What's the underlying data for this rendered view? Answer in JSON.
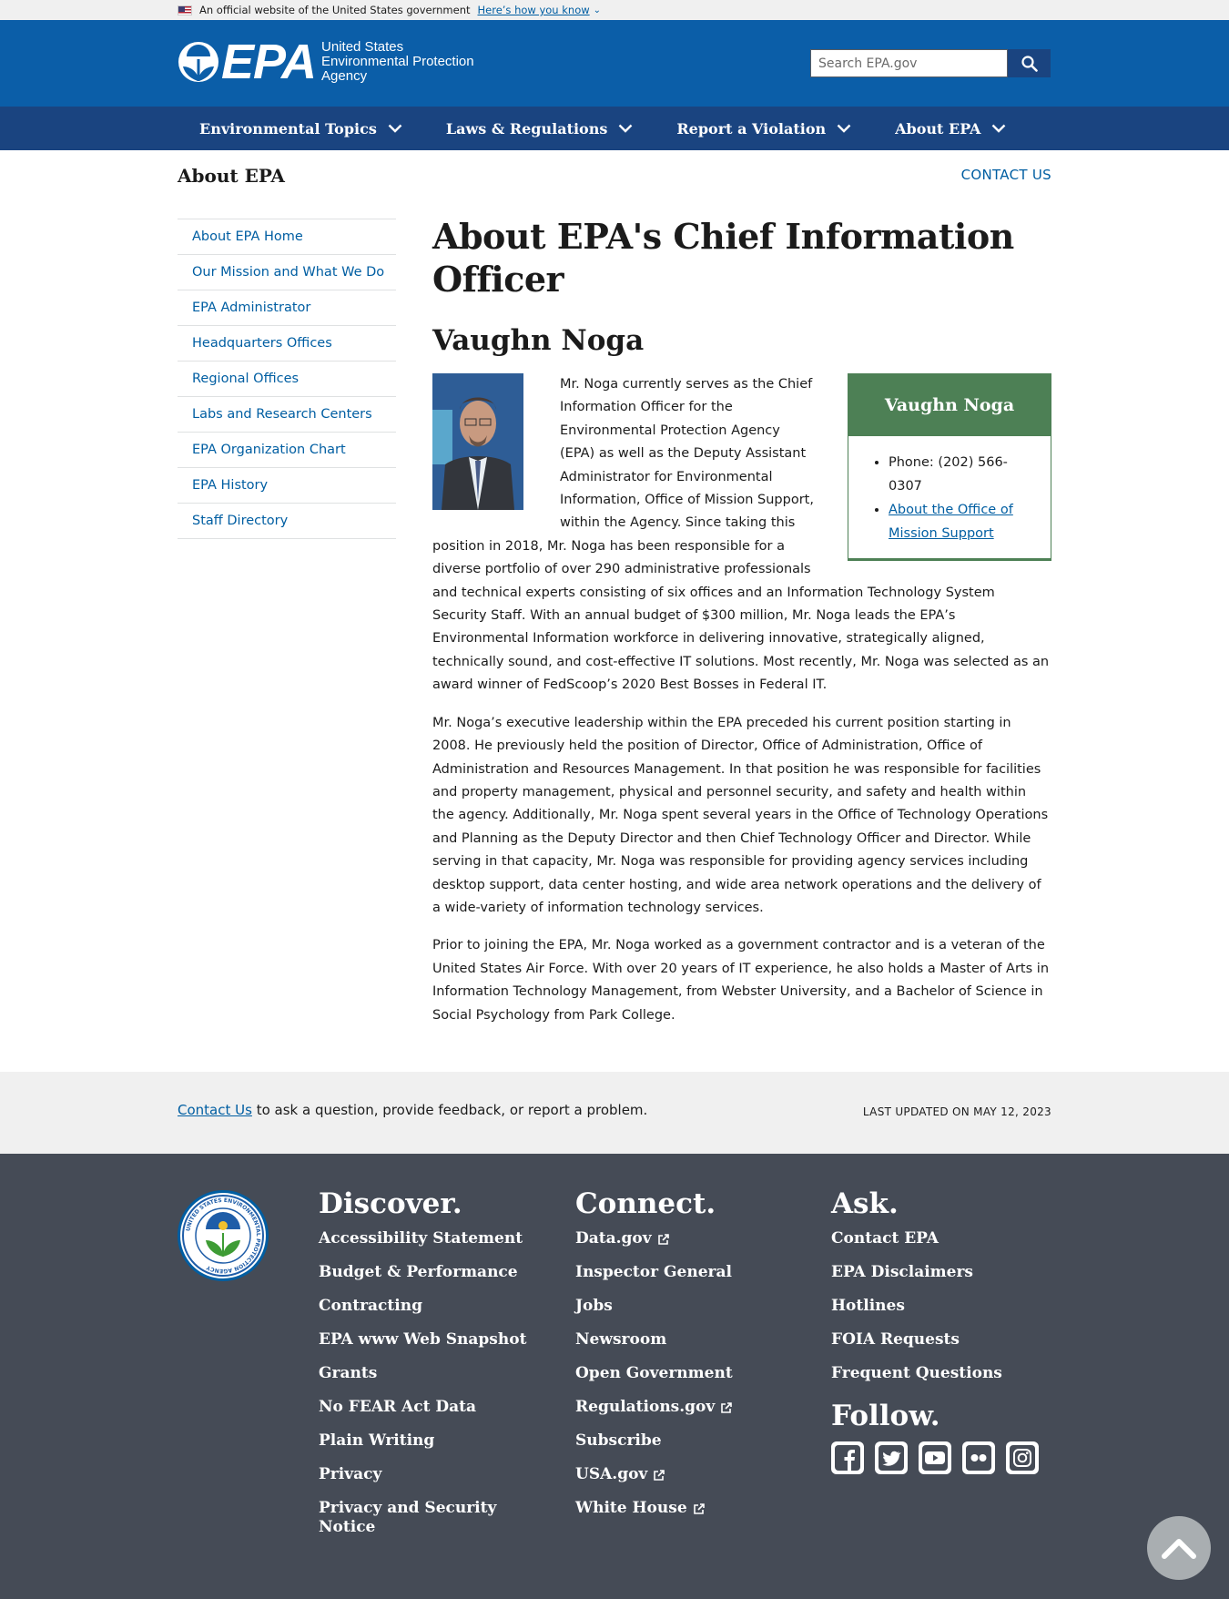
{
  "gov_banner": {
    "text": "An official website of the United States government",
    "link": "Here’s how you know"
  },
  "header": {
    "logo_text": "EPA",
    "agency_line1": "United States",
    "agency_line2": "Environmental Protection",
    "agency_line3": "Agency",
    "search_placeholder": "Search EPA.gov"
  },
  "nav": {
    "items": [
      {
        "label": "Environmental Topics"
      },
      {
        "label": "Laws & Regulations"
      },
      {
        "label": "Report a Violation"
      },
      {
        "label": "About EPA"
      }
    ]
  },
  "page": {
    "section_title": "About EPA",
    "contact_link": "CONTACT US"
  },
  "sidebar": {
    "items": [
      {
        "label": "About EPA Home"
      },
      {
        "label": "Our Mission and What We Do"
      },
      {
        "label": "EPA Administrator"
      },
      {
        "label": "Headquarters Offices"
      },
      {
        "label": "Regional Offices"
      },
      {
        "label": "Labs and Research Centers"
      },
      {
        "label": "EPA Organization Chart"
      },
      {
        "label": "EPA History"
      },
      {
        "label": "Staff Directory"
      }
    ]
  },
  "main": {
    "title": "About EPA's Chief Information Officer",
    "name": "Vaughn Noga",
    "box": {
      "title": "Vaughn Noga",
      "phone": "Phone: (202) 566-0307",
      "link": "About the Office of Mission Support"
    },
    "paragraphs": [
      "Mr. Noga currently serves as the Chief Information Officer for the Environmental Protection Agency (EPA) as well as the Deputy Assistant Administrator for Environmental Information, Office of Mission Support, within the Agency. Since taking this position in 2018, Mr. Noga has been responsible for a diverse portfolio of over 290 administrative professionals and technical experts consisting of six offices and an Information Technology System Security Staff. With an annual budget of $300 million, Mr. Noga leads the EPA’s Environmental Information workforce in delivering innovative, strategically aligned, technically sound, and cost-effective IT solutions.  Most recently, Mr. Noga was selected as an award winner of FedScoop’s 2020 Best Bosses in Federal IT.",
      "Mr. Noga’s executive leadership within the EPA preceded his current position starting in 2008. He previously held the position of Director, Office of Administration, Office of Administration and Resources Management. In that position he was responsible for facilities and property management, physical and personnel security, and safety and health within the agency. Additionally, Mr. Noga spent several years in the Office of Technology Operations and Planning as the Deputy Director and then Chief Technology Officer and Director. While serving in that capacity, Mr. Noga was responsible for providing agency services including desktop support, data center hosting, and wide area network operations and the delivery of a wide-variety of information technology services.",
      "Prior to joining the EPA, Mr. Noga worked as a government contractor and is a veteran of the United States Air Force. With over 20 years of IT experience, he also holds a Master of Arts in Information Technology Management, from Webster University, and a Bachelor of Science in Social Psychology from Park College."
    ]
  },
  "updated": {
    "contact_link": "Contact Us",
    "contact_text": " to ask a question, provide feedback, or report a problem.",
    "last_updated": "LAST UPDATED ON MAY 12, 2023"
  },
  "footer": {
    "seal_text": "UNITED STATES ENVIRONMENTAL PROTECTION AGENCY",
    "discover": {
      "heading": "Discover.",
      "links": [
        "Accessibility Statement",
        "Budget & Performance",
        "Contracting",
        "EPA www Web Snapshot",
        "Grants",
        "No FEAR Act Data",
        "Plain Writing",
        "Privacy",
        "Privacy and Security Notice"
      ]
    },
    "connect": {
      "heading": "Connect.",
      "links": [
        "Data.gov",
        "Inspector General",
        "Jobs",
        "Newsroom",
        "Open Government",
        "Regulations.gov",
        "Subscribe",
        "USA.gov",
        "White House"
      ]
    },
    "ask": {
      "heading": "Ask.",
      "links": [
        "Contact EPA",
        "EPA Disclaimers",
        "Hotlines",
        "FOIA Requests",
        "Frequent Questions"
      ]
    },
    "follow": {
      "heading": "Follow.",
      "icons": [
        "facebook-icon",
        "twitter-icon",
        "youtube-icon",
        "flickr-icon",
        "instagram-icon"
      ]
    }
  },
  "colors": {
    "header_blue": "#0b5ea8",
    "nav_blue": "#1a4480",
    "link_blue": "#005ea2",
    "box_green": "#4d8055",
    "footer_gray": "#454b56"
  }
}
